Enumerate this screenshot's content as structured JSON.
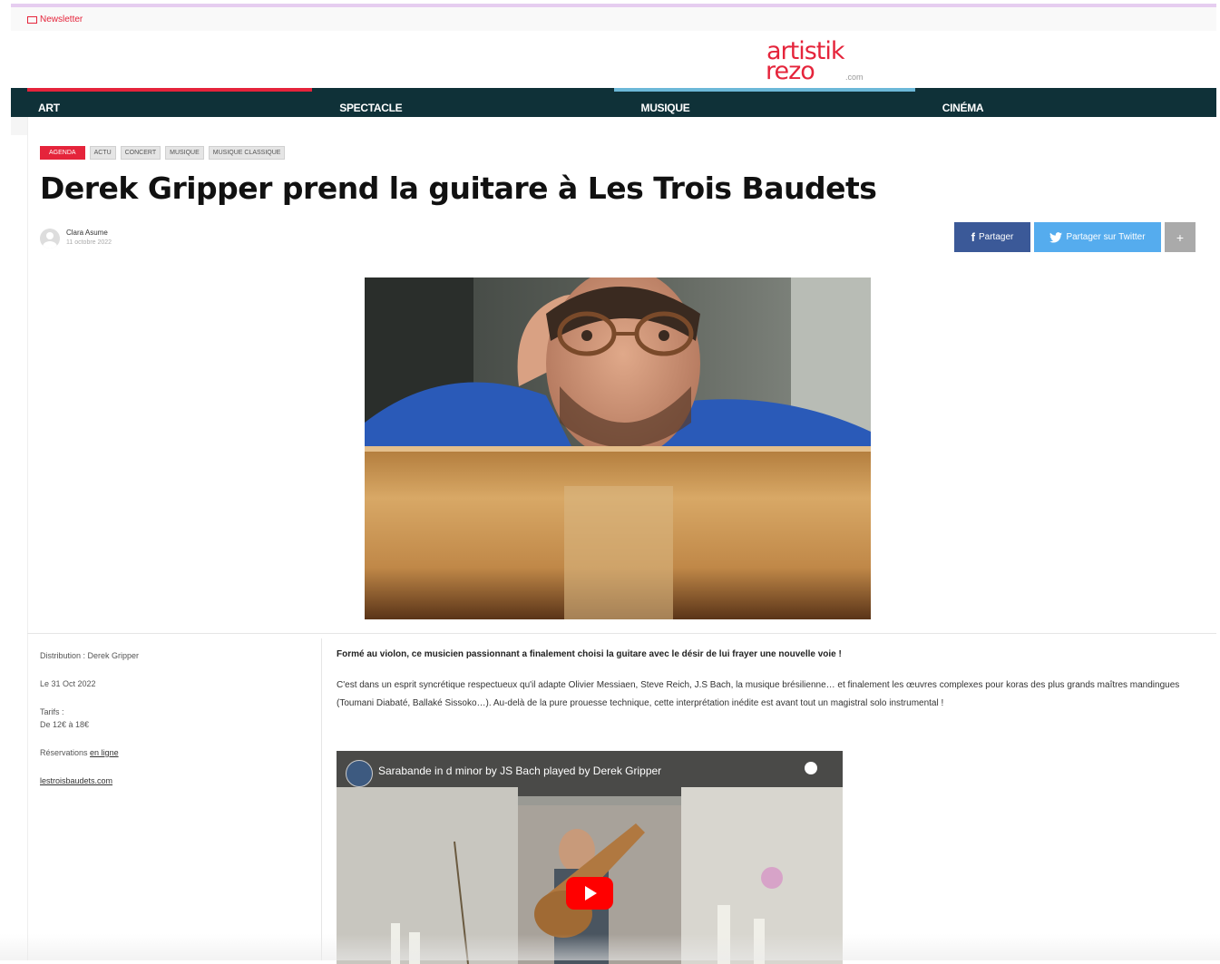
{
  "header": {
    "newsletter_label": "Newsletter",
    "logo_line1": "artistik",
    "logo_line2": "rezo",
    "logo_suffix": ".com"
  },
  "nav": {
    "items": [
      {
        "label": "ART"
      },
      {
        "label": "SPECTACLE"
      },
      {
        "label": "MUSIQUE"
      },
      {
        "label": "CINÉMA"
      }
    ]
  },
  "tags": [
    "AGENDA",
    "ACTU",
    "CONCERT",
    "MUSIQUE",
    "MUSIQUE CLASSIQUE"
  ],
  "article": {
    "title": "Derek Gripper prend la guitare à Les Trois Baudets",
    "author": "Clara Asume",
    "date": "11 octobre 2022"
  },
  "share": {
    "facebook_label": "Partager",
    "twitter_label": "Partager sur Twitter",
    "more_label": "+"
  },
  "sidebar": {
    "distribution": "Distribution : Derek Gripper",
    "event_date": "Le 31 Oct 2022",
    "tarifs_label": "Tarifs :",
    "tarifs_value": "De 12€ à 18€",
    "reservations_prefix": "Réservations",
    "reservations_link": "en ligne",
    "website_link": "lestroisbaudets.com"
  },
  "main": {
    "lead": "Formé au violon, ce musicien passionnant a finalement choisi la guitare avec le désir de lui frayer une nouvelle voie !",
    "body": "C'est dans un esprit syncrétique respectueux qu'il adapte Olivier Messiaen, Steve Reich, J.S Bach, la musique brésilienne… et finalement les œuvres complexes pour koras des plus grands maîtres mandingues (Toumani Diabaté, Ballaké Sissoko…). Au-delà de la pure prouesse technique, cette interprétation inédite est avant tout un magistral solo instrumental !"
  },
  "video": {
    "title": "Sarabande in d minor by JS Bach played by Derek Gripper"
  },
  "colors": {
    "accent": "#e5243b",
    "nav_bg": "#0f3138",
    "facebook": "#3b5998",
    "twitter": "#55acee"
  }
}
